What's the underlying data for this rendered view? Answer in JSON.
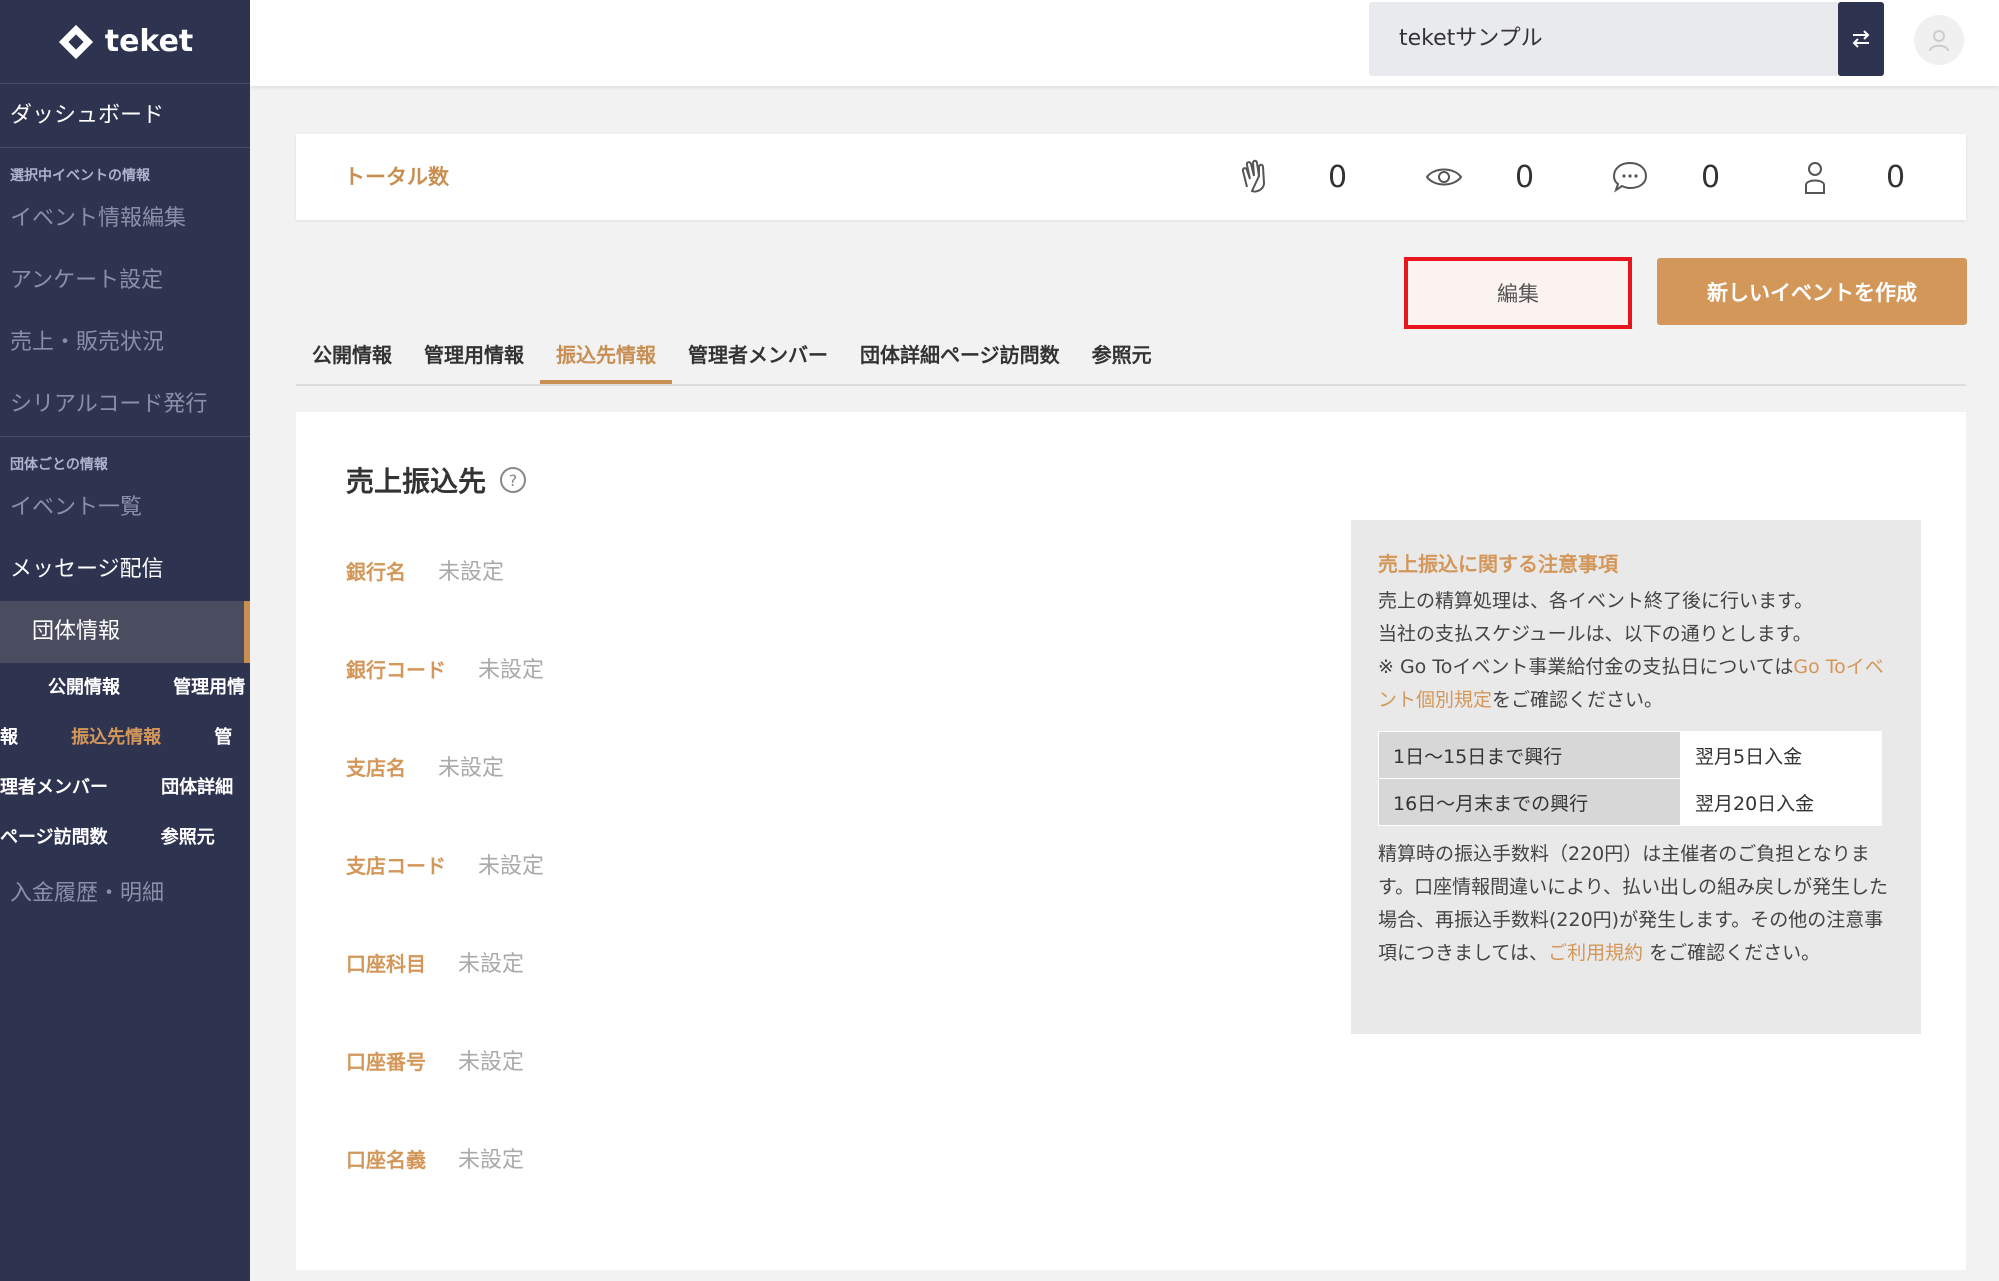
{
  "app": {
    "logo_text": "teket"
  },
  "sidebar": {
    "dashboard": "ダッシュボード",
    "section1": "選択中イベントの情報",
    "event_items": [
      "イベント情報編集",
      "アンケート設定",
      "売上・販売状況",
      "シリアルコード発行"
    ],
    "section2": "団体ごとの情報",
    "event_list": "イベント一覧",
    "message": "メッセージ配信",
    "group_info": "団体情報",
    "sub_items": [
      "公開情報",
      "管理用情報",
      "振込先情報",
      "管理者メンバー",
      "団体詳細ページ訪問数",
      "参照元"
    ],
    "payments": "入金履歴・明細"
  },
  "topbar": {
    "org_name": "teketサンプル"
  },
  "stats": {
    "title": "トータル数",
    "items": [
      {
        "icon": "clap-icon",
        "value": "0"
      },
      {
        "icon": "eye-icon",
        "value": "0"
      },
      {
        "icon": "comment-icon",
        "value": "0"
      },
      {
        "icon": "person-icon",
        "value": "0"
      }
    ]
  },
  "buttons": {
    "edit": "編集",
    "new_event": "新しいイベントを作成"
  },
  "tabs": [
    "公開情報",
    "管理用情報",
    "振込先情報",
    "管理者メンバー",
    "団体詳細ページ訪問数",
    "参照元"
  ],
  "section": {
    "title": "売上振込先",
    "help": "?",
    "fields": [
      {
        "label": "銀行名",
        "value": "未設定"
      },
      {
        "label": "銀行コード",
        "value": "未設定"
      },
      {
        "label": "支店名",
        "value": "未設定"
      },
      {
        "label": "支店コード",
        "value": "未設定"
      },
      {
        "label": "口座科目",
        "value": "未設定"
      },
      {
        "label": "口座番号",
        "value": "未設定"
      },
      {
        "label": "口座名義",
        "value": "未設定"
      }
    ]
  },
  "notice": {
    "title": "売上振込に関する注意事項",
    "line1": "売上の精算処理は、各イベント終了後に行います。",
    "line2": "当社の支払スケジュールは、以下の通りとします。",
    "line3_pre": "※ Go Toイベント事業給付金の支払日については",
    "line3_link": "Go Toイベント個別規定",
    "line3_post": "をご確認ください。",
    "schedule": [
      {
        "period": "1日～15日まで興行",
        "payment": "翌月5日入金"
      },
      {
        "period": "16日～月末までの興行",
        "payment": "翌月20日入金"
      }
    ],
    "footer_pre": "精算時の振込手数料（220円）は主催者のご負担となります。口座情報間違いにより、払い出しの組み戻しが発生した場合、再振込手数料(220円)が発生します。その他の注意事項につきましては、",
    "footer_link": "ご利用規約",
    "footer_post": " をご確認ください。"
  }
}
